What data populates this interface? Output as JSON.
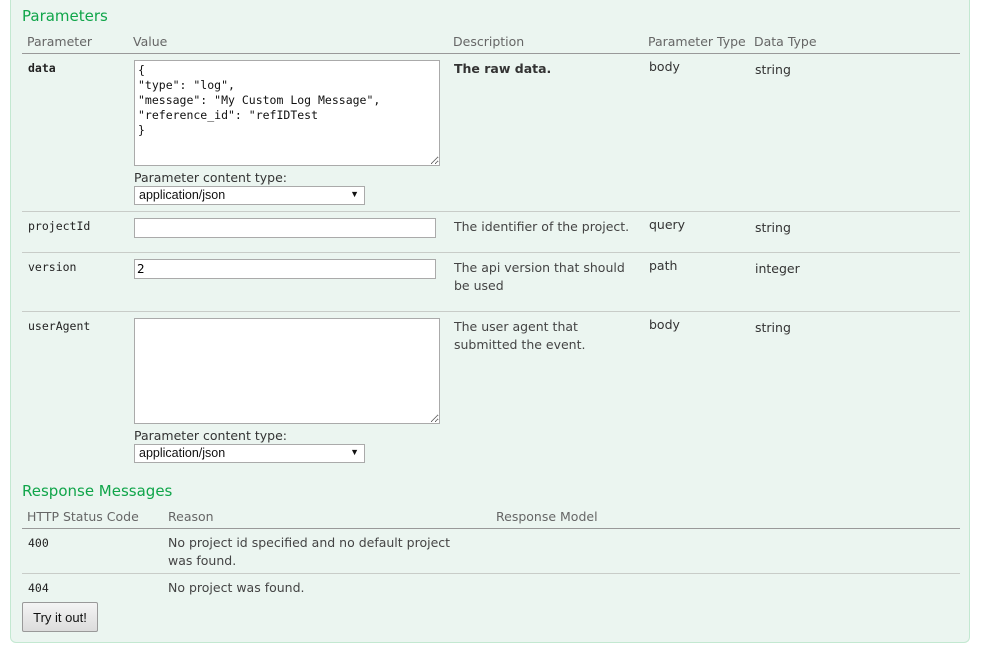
{
  "parameters": {
    "title": "Parameters",
    "columns": [
      "Parameter",
      "Value",
      "Description",
      "Parameter Type",
      "Data Type"
    ],
    "rows": [
      {
        "name": "data",
        "value": "{\n\"type\": \"log\",\n\"message\": \"My Custom Log Message\",\n\"reference_id\": \"refIDTest\n}",
        "input_kind": "textarea",
        "content_type_label": "Parameter content type:",
        "content_type": "application/json",
        "description": "The raw data.",
        "param_type": "body",
        "data_type": "string"
      },
      {
        "name": "projectId",
        "value": "",
        "input_kind": "text",
        "description": "The identifier of the project.",
        "param_type": "query",
        "data_type": "string"
      },
      {
        "name": "version",
        "value": "2",
        "input_kind": "text",
        "description": "The api version that should be used",
        "param_type": "path",
        "data_type": "integer"
      },
      {
        "name": "userAgent",
        "value": "",
        "input_kind": "textarea",
        "content_type_label": "Parameter content type:",
        "content_type": "application/json",
        "description": "The user agent that submitted the event.",
        "param_type": "body",
        "data_type": "string"
      }
    ]
  },
  "responses": {
    "title": "Response Messages",
    "columns": [
      "HTTP Status Code",
      "Reason",
      "Response Model"
    ],
    "rows": [
      {
        "code": "400",
        "reason": "No project id specified and no default project was found.",
        "model": ""
      },
      {
        "code": "404",
        "reason": "No project was found.",
        "model": ""
      }
    ]
  },
  "actions": {
    "try_label": "Try it out!"
  },
  "icons": {
    "dropdown_arrow": "▼"
  },
  "colors": {
    "accent": "#10a54a",
    "panel_bg": "#ebf5f0",
    "panel_border": "#c3e8d1"
  }
}
